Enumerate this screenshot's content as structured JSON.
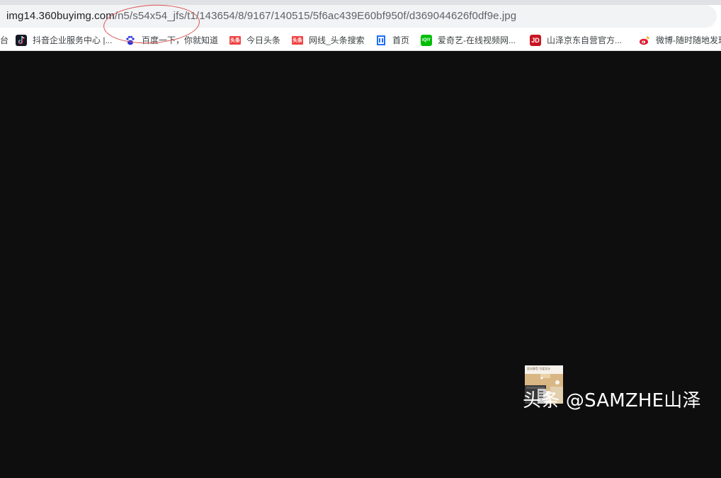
{
  "address_bar": {
    "url_domain": "img14.360buyimg.com",
    "url_path": "/n5/s54x54_jfs/t1/143654/8/9167/140515/5f6ac439E60bf950f/d369044626f0df9e.jpg"
  },
  "bookmarks": [
    {
      "label": "台",
      "icon": "partial-bookmark-icon"
    },
    {
      "label": "抖音企业服务中心 |...",
      "icon": "douyin-icon",
      "color": "#161823"
    },
    {
      "label": "百度一下，你就知道",
      "icon": "baidu-paw-icon",
      "color": "#2932e1"
    },
    {
      "label": "今日头条",
      "icon": "toutiao-icon",
      "color": "#f04142",
      "icon_text": "头条"
    },
    {
      "label": "网线_头条搜索",
      "icon": "toutiao-search-icon",
      "color": "#f04142",
      "icon_text": "头条"
    },
    {
      "label": "首页",
      "icon": "homepage-icon",
      "color": "#1e6fff"
    },
    {
      "label": "爱奇艺-在线视频网...",
      "icon": "iqiyi-icon",
      "color": "#00be06",
      "icon_text": "iQIY"
    },
    {
      "label": "山泽京东自营官方...",
      "icon": "jd-icon",
      "color": "#c91623",
      "icon_text": "JD"
    },
    {
      "label": "微博-随时随地发现",
      "icon": "weibo-icon",
      "color": "#e6162d"
    }
  ],
  "thumbnail": {
    "icon": "product-thumbnail-image",
    "caption": "超长静音 为爱设计"
  },
  "watermark": {
    "text": "头条 @SAMZHE山泽"
  },
  "colors": {
    "page_background": "#0e0e0e",
    "annotation_circle": "#d9534f",
    "address_pill": "#f1f3f4"
  }
}
